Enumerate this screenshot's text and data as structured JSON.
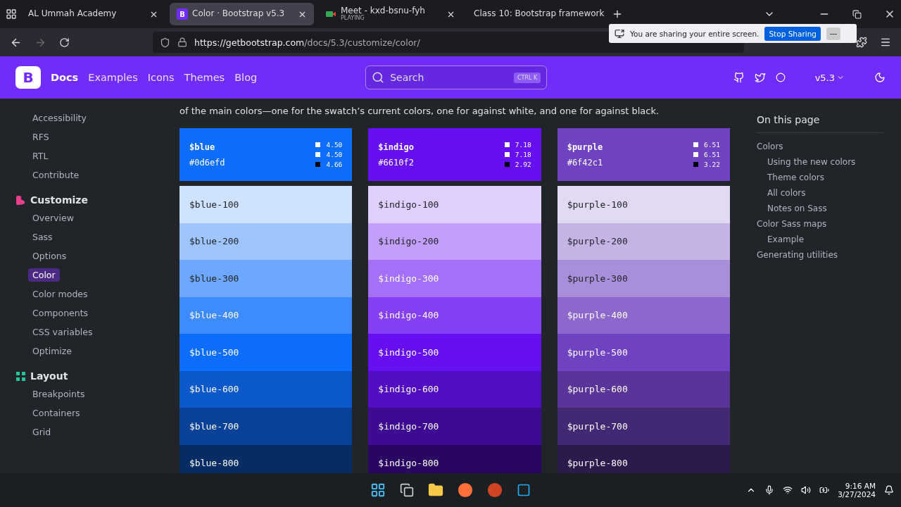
{
  "browser": {
    "tabs": [
      {
        "title": "AL Ummah Academy",
        "selected": false,
        "kind": "plain"
      },
      {
        "title": "Color · Bootstrap v5.3",
        "selected": true,
        "kind": "bootstrap",
        "favicon": "B"
      },
      {
        "title": "Meet - kxd-bsnu-fyh",
        "subtitle": "PLAYING",
        "selected": false,
        "kind": "meet"
      },
      {
        "title": "Class 10: Bootstrap framework",
        "selected": false,
        "kind": "plain"
      }
    ],
    "url_host": "https://getbootstrap.com",
    "url_path": "/docs/5.3/customize/color/",
    "sharing": {
      "message": "You are sharing your entire screen.",
      "stop": "Stop Sharing",
      "hide": "—"
    }
  },
  "navbar": {
    "logo": "B",
    "links": [
      {
        "label": "Docs",
        "selected": true
      },
      {
        "label": "Examples",
        "selected": false
      },
      {
        "label": "Icons",
        "selected": false
      },
      {
        "label": "Themes",
        "selected": false
      },
      {
        "label": "Blog",
        "selected": false
      }
    ],
    "search": {
      "placeholder": "Search",
      "shortcut": "CTRL K"
    },
    "version": "v5.3"
  },
  "sidebar": {
    "groups": [
      {
        "items": [
          {
            "label": "Accessibility",
            "selected": false
          },
          {
            "label": "RFS",
            "selected": false
          },
          {
            "label": "RTL",
            "selected": false
          },
          {
            "label": "Contribute",
            "selected": false
          }
        ]
      },
      {
        "title": "Customize",
        "color": "#e83e8c",
        "items": [
          {
            "label": "Overview",
            "selected": false
          },
          {
            "label": "Sass",
            "selected": false
          },
          {
            "label": "Options",
            "selected": false
          },
          {
            "label": "Color",
            "selected": true
          },
          {
            "label": "Color modes",
            "selected": false
          },
          {
            "label": "Components",
            "selected": false
          },
          {
            "label": "CSS variables",
            "selected": false
          },
          {
            "label": "Optimize",
            "selected": false
          }
        ]
      },
      {
        "title": "Layout",
        "color": "#20c997",
        "items": [
          {
            "label": "Breakpoints",
            "selected": false
          },
          {
            "label": "Containers",
            "selected": false
          },
          {
            "label": "Grid",
            "selected": false
          }
        ]
      }
    ]
  },
  "intro": "of the main colors—one for the swatch’s current colors, one for against white, and one for against black.",
  "palettes": [
    {
      "name": "$blue",
      "hex": "#0d6efd",
      "color": "#0d6efd",
      "contrast": [
        {
          "value": "4.50",
          "color": "#ffffff"
        },
        {
          "value": "4.50",
          "color": "#ffffff"
        },
        {
          "value": "4.66",
          "color": "#000000"
        }
      ],
      "shades": [
        {
          "name": "$blue-100",
          "color": "#cfe2ff"
        },
        {
          "name": "$blue-200",
          "color": "#9ec5fe"
        },
        {
          "name": "$blue-300",
          "color": "#6ea8fe"
        },
        {
          "name": "$blue-400",
          "color": "#3d8bfd"
        },
        {
          "name": "$blue-500",
          "color": "#0d6efd"
        },
        {
          "name": "$blue-600",
          "color": "#0a58ca"
        },
        {
          "name": "$blue-700",
          "color": "#084298"
        },
        {
          "name": "$blue-800",
          "color": "#052c65"
        }
      ]
    },
    {
      "name": "$indigo",
      "hex": "#6610f2",
      "color": "#6610f2",
      "contrast": [
        {
          "value": "7.18",
          "color": "#ffffff"
        },
        {
          "value": "7.18",
          "color": "#ffffff"
        },
        {
          "value": "2.92",
          "color": "#000000"
        }
      ],
      "shades": [
        {
          "name": "$indigo-100",
          "color": "#e0cffc"
        },
        {
          "name": "$indigo-200",
          "color": "#c29ffa"
        },
        {
          "name": "$indigo-300",
          "color": "#a370f7"
        },
        {
          "name": "$indigo-400",
          "color": "#8540f5"
        },
        {
          "name": "$indigo-500",
          "color": "#6610f2"
        },
        {
          "name": "$indigo-600",
          "color": "#520dc2"
        },
        {
          "name": "$indigo-700",
          "color": "#3d0a91"
        },
        {
          "name": "$indigo-800",
          "color": "#290661"
        }
      ]
    },
    {
      "name": "$purple",
      "hex": "#6f42c1",
      "color": "#6f42c1",
      "contrast": [
        {
          "value": "6.51",
          "color": "#ffffff"
        },
        {
          "value": "6.51",
          "color": "#ffffff"
        },
        {
          "value": "3.22",
          "color": "#000000"
        }
      ],
      "shades": [
        {
          "name": "$purple-100",
          "color": "#e2d9f3"
        },
        {
          "name": "$purple-200",
          "color": "#c5b3e6"
        },
        {
          "name": "$purple-300",
          "color": "#a98eda"
        },
        {
          "name": "$purple-400",
          "color": "#8c68cd"
        },
        {
          "name": "$purple-500",
          "color": "#6f42c1"
        },
        {
          "name": "$purple-600",
          "color": "#59359a"
        },
        {
          "name": "$purple-700",
          "color": "#432874"
        },
        {
          "name": "$purple-800",
          "color": "#2c1a4d"
        }
      ]
    }
  ],
  "toc": {
    "title": "On this page",
    "items": [
      {
        "label": "Colors",
        "children": [
          {
            "label": "Using the new colors"
          },
          {
            "label": "Theme colors"
          },
          {
            "label": "All colors"
          },
          {
            "label": "Notes on Sass"
          }
        ]
      },
      {
        "label": "Color Sass maps",
        "children": [
          {
            "label": "Example"
          }
        ]
      },
      {
        "label": "Generating utilities"
      }
    ]
  },
  "taskbar": {
    "time": "9:16 AM",
    "date": "3/27/2024"
  }
}
